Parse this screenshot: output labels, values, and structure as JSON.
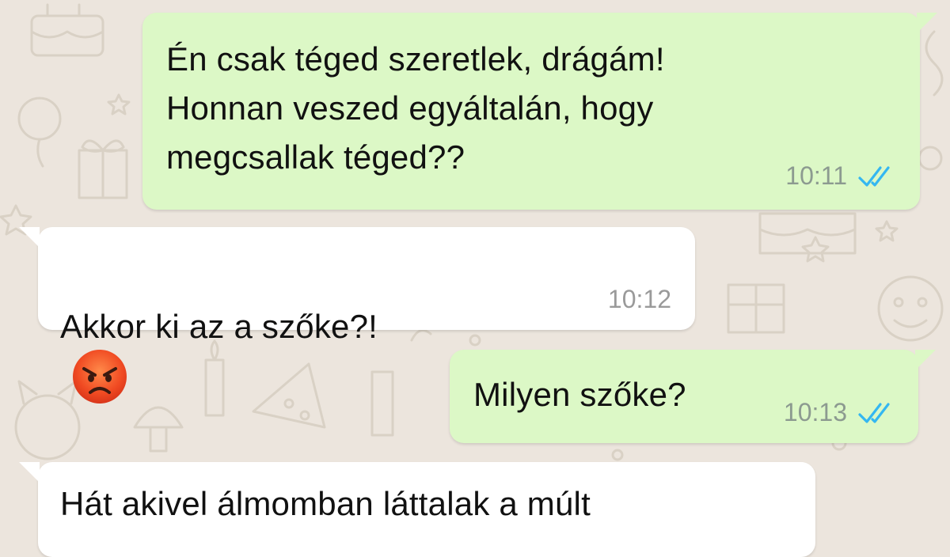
{
  "chat": {
    "messages": [
      {
        "direction": "outgoing",
        "text": "Én csak téged szeretlek, drágám!\nHonnan veszed egyáltalán, hogy\nmegcsallak téged??",
        "time": "10:11",
        "status": "read",
        "status_icon": "double-check-icon"
      },
      {
        "direction": "incoming",
        "text": "Akkor ki az a szőke?!",
        "emoji": "angry-face-emoji",
        "time": "10:12"
      },
      {
        "direction": "outgoing",
        "text": "Milyen szőke?",
        "time": "10:13",
        "status": "read",
        "status_icon": "double-check-icon"
      },
      {
        "direction": "incoming",
        "text": "Hát akivel álmomban láttalak a múlt"
      }
    ]
  },
  "colors": {
    "background": "#ece5dd",
    "outgoing_bubble": "#dcf8c6",
    "incoming_bubble": "#ffffff",
    "read_ticks": "#34b7f1"
  }
}
